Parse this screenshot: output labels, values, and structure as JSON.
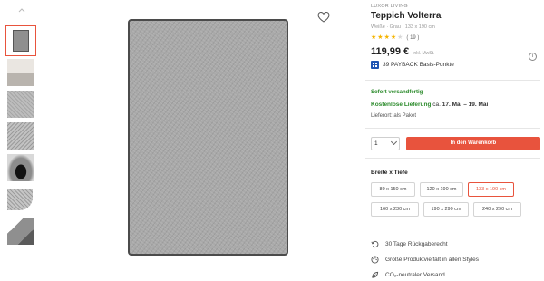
{
  "product": {
    "brand": "LUXOR LIVING",
    "title": "Teppich Volterra",
    "subtitle": "Weiße · Grau · 133 x 190 cm",
    "rating_value": 4.5,
    "rating_count": "( 19 )",
    "price": "119,99 €",
    "price_note": "inkl. MwSt.",
    "payback": "39 PAYBACK Basis-Punkte"
  },
  "delivery": {
    "availability": "Sofort versandfertig",
    "free_label": "Kostenlose Lieferung",
    "ca": "ca.",
    "dates": "17. Mai – 19. Mai",
    "location": "Lieferort: als Paket"
  },
  "purchase": {
    "quantity": "1",
    "cart_button": "In den Warenkorb"
  },
  "sizes": {
    "label": "Breite x Tiefe",
    "options": [
      "80 x 150 cm",
      "120 x 190 cm",
      "133 x 190 cm",
      "160 x 230 cm",
      "190 x 290 cm",
      "240 x 290 cm"
    ],
    "selected": "133 x 190 cm"
  },
  "features": [
    {
      "icon": "return-icon",
      "text": "30 Tage Rückgaberecht"
    },
    {
      "icon": "palette-icon",
      "text": "Große Produktvielfalt in allen Styles"
    },
    {
      "icon": "leaf-icon",
      "text": "CO₂-neutraler Versand"
    }
  ],
  "colors": {
    "accent": "#e8533d",
    "green": "#2a8a2a",
    "star": "#f5b400",
    "payback": "#1f55b3"
  }
}
